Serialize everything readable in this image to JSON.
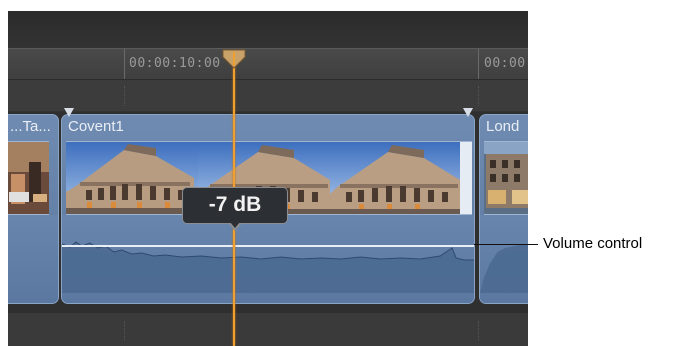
{
  "ruler": {
    "timecode_1": "00:00:10:00",
    "timecode_2": "00:00"
  },
  "clips": [
    {
      "name": "...Ta..."
    },
    {
      "name": "Covent1"
    },
    {
      "name": "Lond"
    }
  ],
  "volume_popup": {
    "value": "-7 dB"
  },
  "callout": {
    "label": "Volume control"
  },
  "colors": {
    "clip_blue": "#6f8bb1",
    "playhead_orange": "#f0a030",
    "timeline_bg": "#454545"
  },
  "icons": {
    "playhead": "playhead-handle-icon",
    "marker": "clip-marker-icon"
  }
}
